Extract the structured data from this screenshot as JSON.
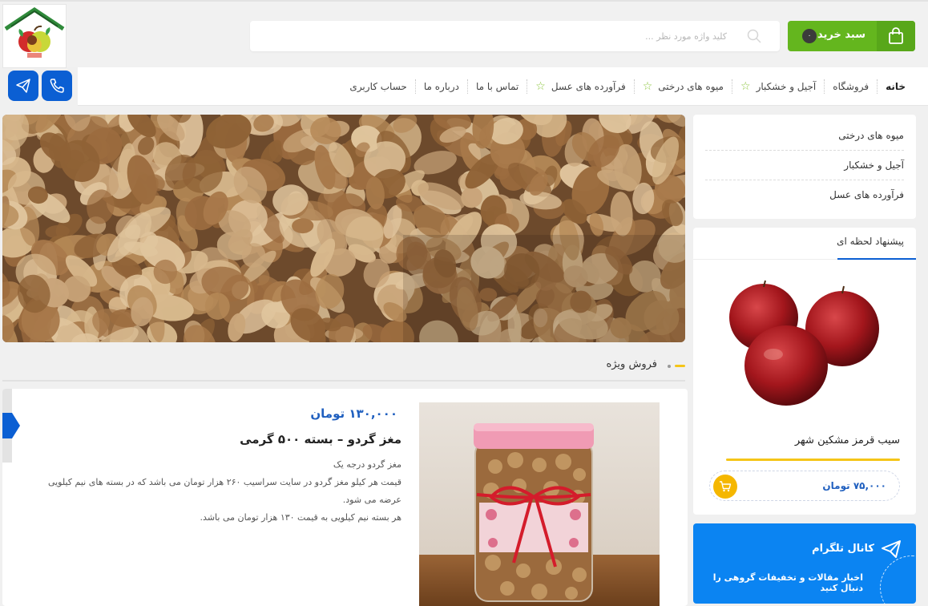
{
  "header": {
    "search": {
      "placeholder": "کلید واژه مورد نظر ..."
    },
    "cart": {
      "label": "سبد خرید",
      "count": "۰"
    }
  },
  "nav": {
    "items": [
      {
        "label": "خانه",
        "active": true
      },
      {
        "label": "فروشگاه"
      },
      {
        "label": "آجیل و خشکبار",
        "star": true
      },
      {
        "label": "میوه های درختی",
        "star": true
      },
      {
        "label": "فرآورده های عسل",
        "star": true
      },
      {
        "label": "تماس با ما"
      },
      {
        "label": "درباره ما"
      },
      {
        "label": "حساب کاربری"
      }
    ]
  },
  "sidebar": {
    "categories": [
      "میوه های درختی",
      "آجیل و خشکبار",
      "فرآورده های عسل"
    ],
    "offer": {
      "title": "پیشنهاد لحظه ای",
      "product_name": "سیب قرمز مشکین شهر",
      "price": "۷۵,۰۰۰ تومان",
      "progress": 1.0
    },
    "telegram": {
      "title": "کانال تلگرام",
      "subtitle": "اخبار مقالات و تخفیفات گروهی را دنبال کنید"
    }
  },
  "main": {
    "section_title": "فروش ویژه",
    "product": {
      "price": "۱۳۰,۰۰۰ تومان",
      "title": "مغز گردو – بسته ۵۰۰ گرمی",
      "desc": [
        "مغز گردو درجه یک",
        "قیمت هر کیلو مغز گردو در سایت سراسیب ۲۶۰ هزار تومان می باشد که در بسته های نیم کیلویی عرضه می شود.",
        "هر بسته نیم کیلویی به قیمت ۱۳۰ هزار تومان می باشد."
      ]
    }
  },
  "colors": {
    "accent_blue": "#0b5fd3",
    "cart_green": "#64b61e",
    "highlight_yellow": "#f5c518",
    "telegram_blue": "#0b84f2"
  },
  "icons": [
    "logo-house-apple",
    "search-icon",
    "shopping-bag-icon",
    "phone-icon",
    "telegram-icon",
    "star-icon",
    "cart-icon"
  ]
}
